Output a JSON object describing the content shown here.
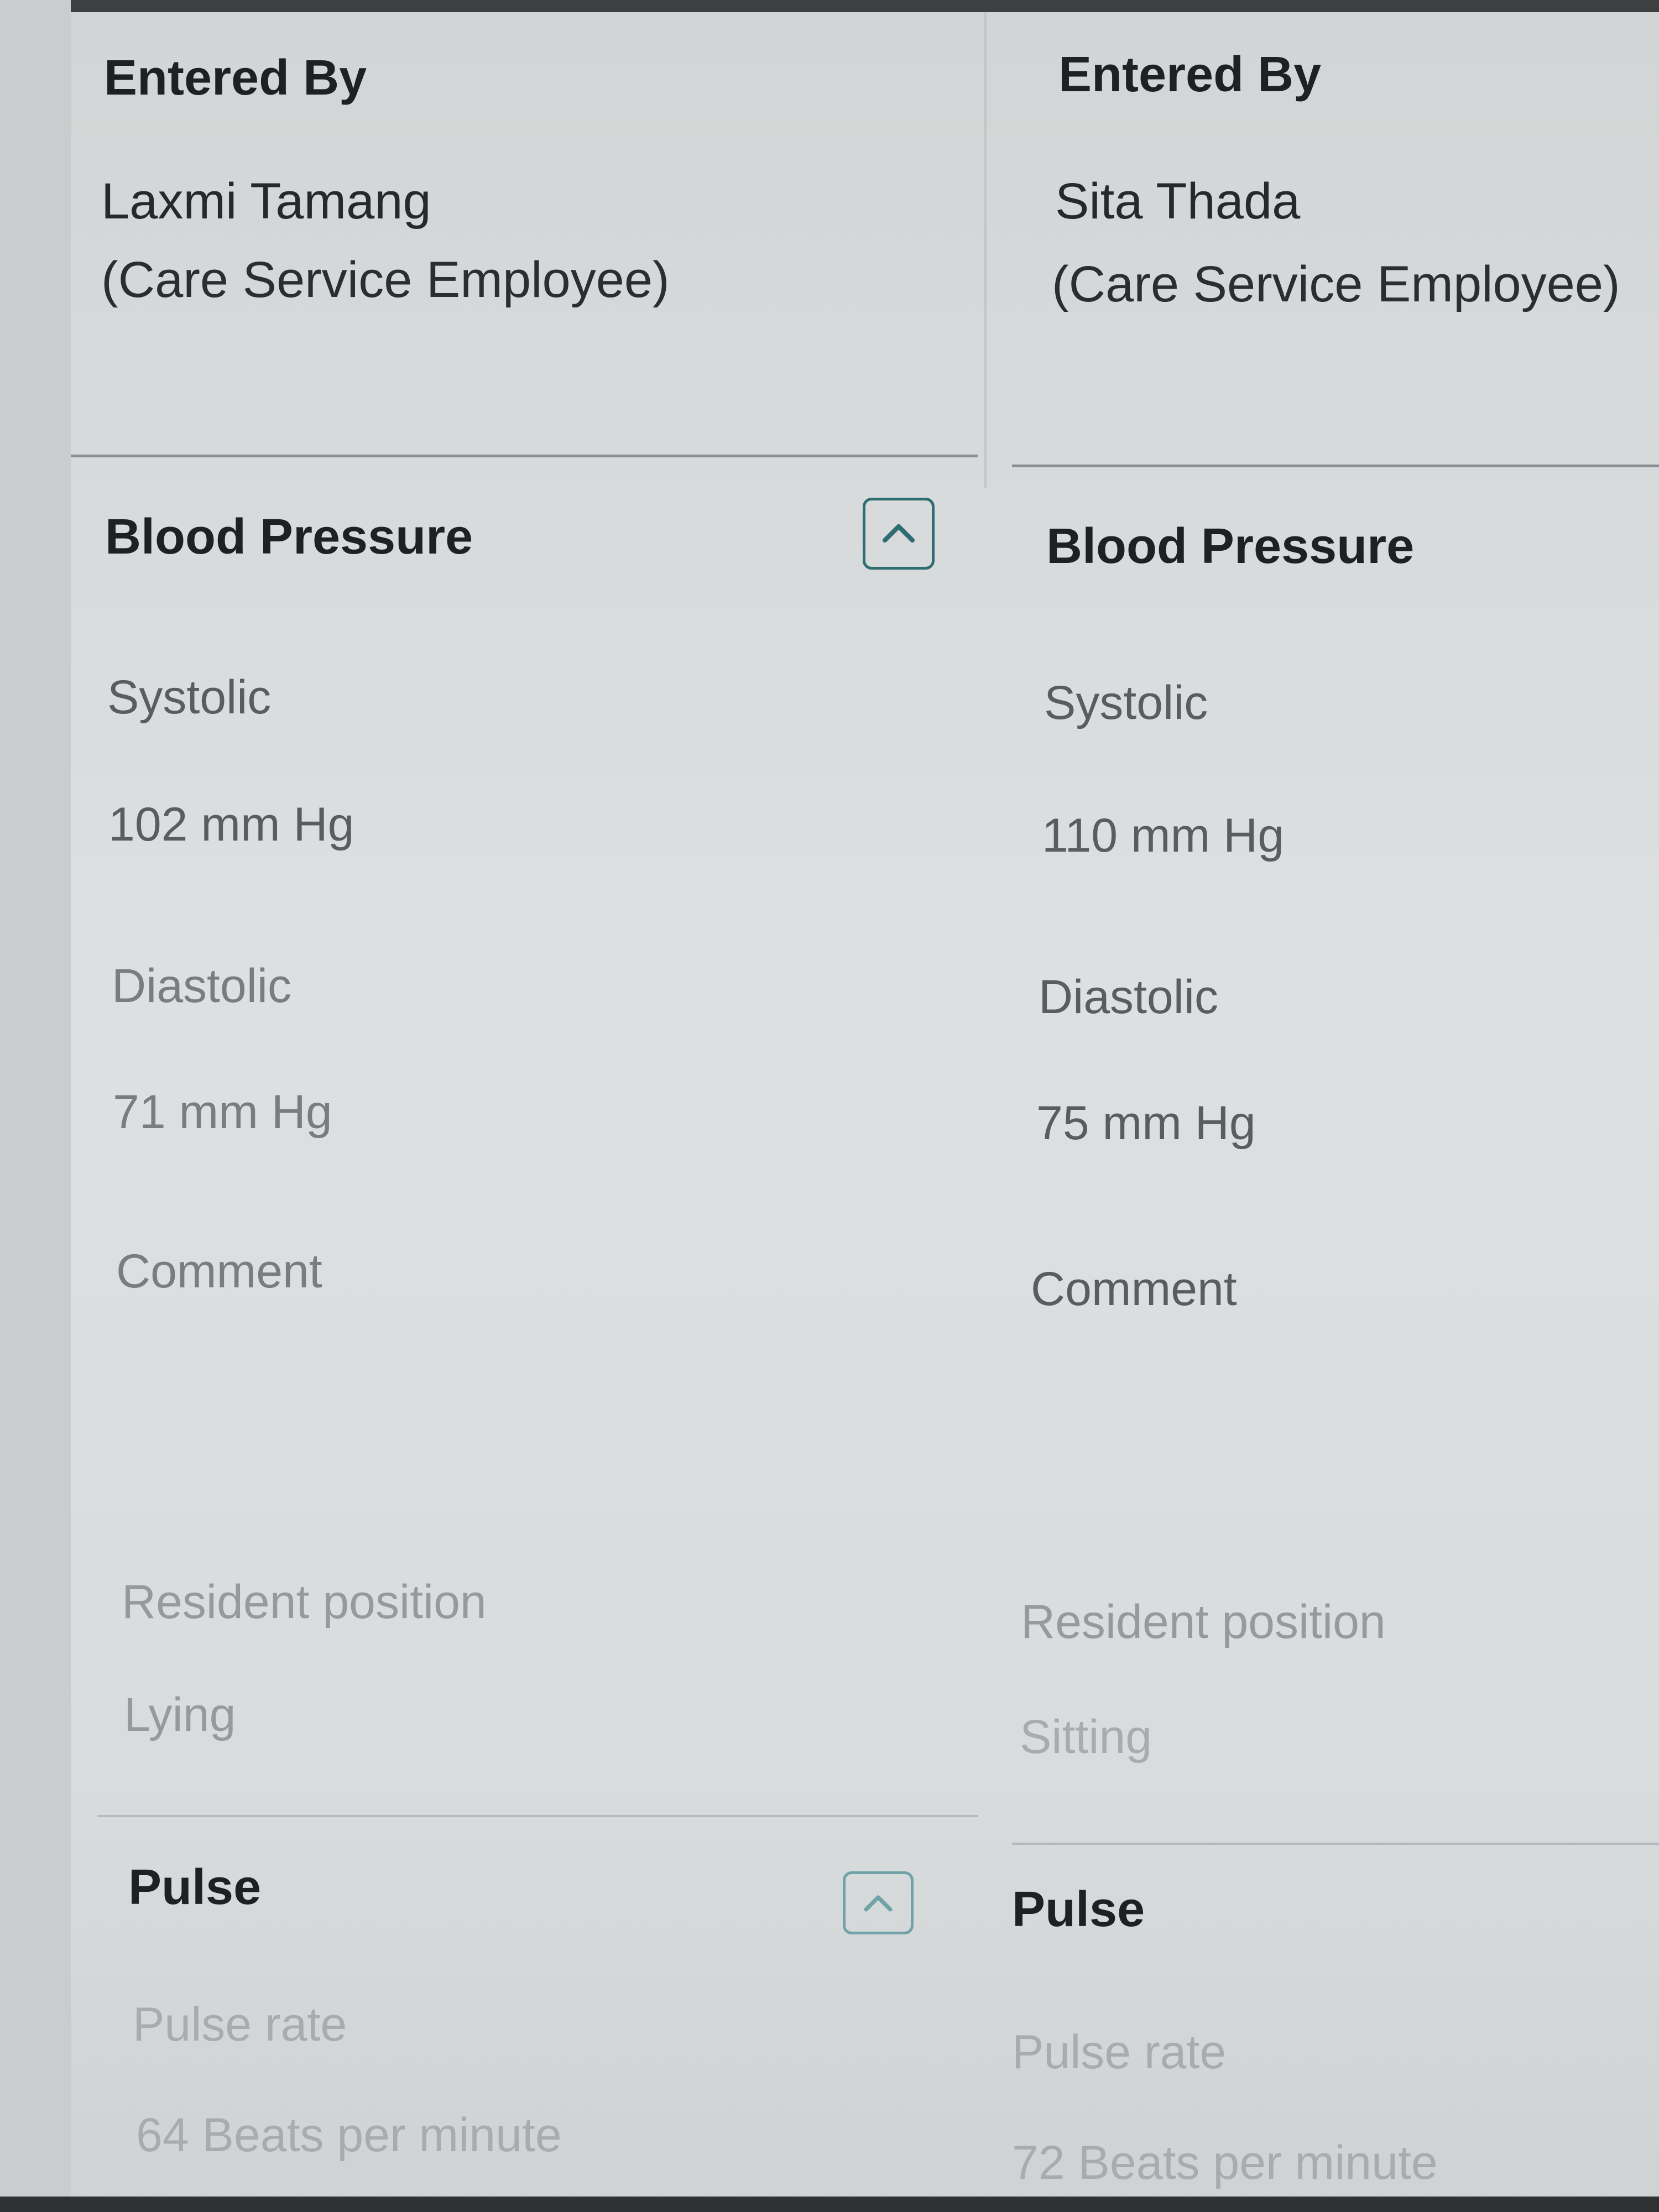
{
  "records": [
    {
      "entered_by": {
        "heading": "Entered By",
        "name": "Laxmi Tamang",
        "role": "(Care Service Employee)"
      },
      "blood_pressure": {
        "heading": "Blood Pressure",
        "systolic_label": "Systolic",
        "systolic_value": "102 mm Hg",
        "diastolic_label": "Diastolic",
        "diastolic_value": "71 mm Hg",
        "comment_label": "Comment",
        "position_label": "Resident position",
        "position_value": "Lying",
        "collapse_icon": "chevron-up-icon"
      },
      "pulse": {
        "heading": "Pulse",
        "rate_label": "Pulse rate",
        "rate_value": "64 Beats per minute",
        "collapse_icon": "chevron-up-icon"
      }
    },
    {
      "entered_by": {
        "heading": "Entered By",
        "name": "Sita Thada",
        "role": "(Care Service Employee)"
      },
      "blood_pressure": {
        "heading": "Blood Pressure",
        "systolic_label": "Systolic",
        "systolic_value": "110 mm Hg",
        "diastolic_label": "Diastolic",
        "diastolic_value": "75 mm Hg",
        "comment_label": "Comment",
        "position_label": "Resident position",
        "position_value": "Sitting"
      },
      "pulse": {
        "heading": "Pulse",
        "rate_label": "Pulse rate",
        "rate_value": "72 Beats per minute"
      }
    }
  ],
  "colors": {
    "accent": "#2e6e73",
    "text": "#26292b",
    "background": "#d8dbdc"
  }
}
